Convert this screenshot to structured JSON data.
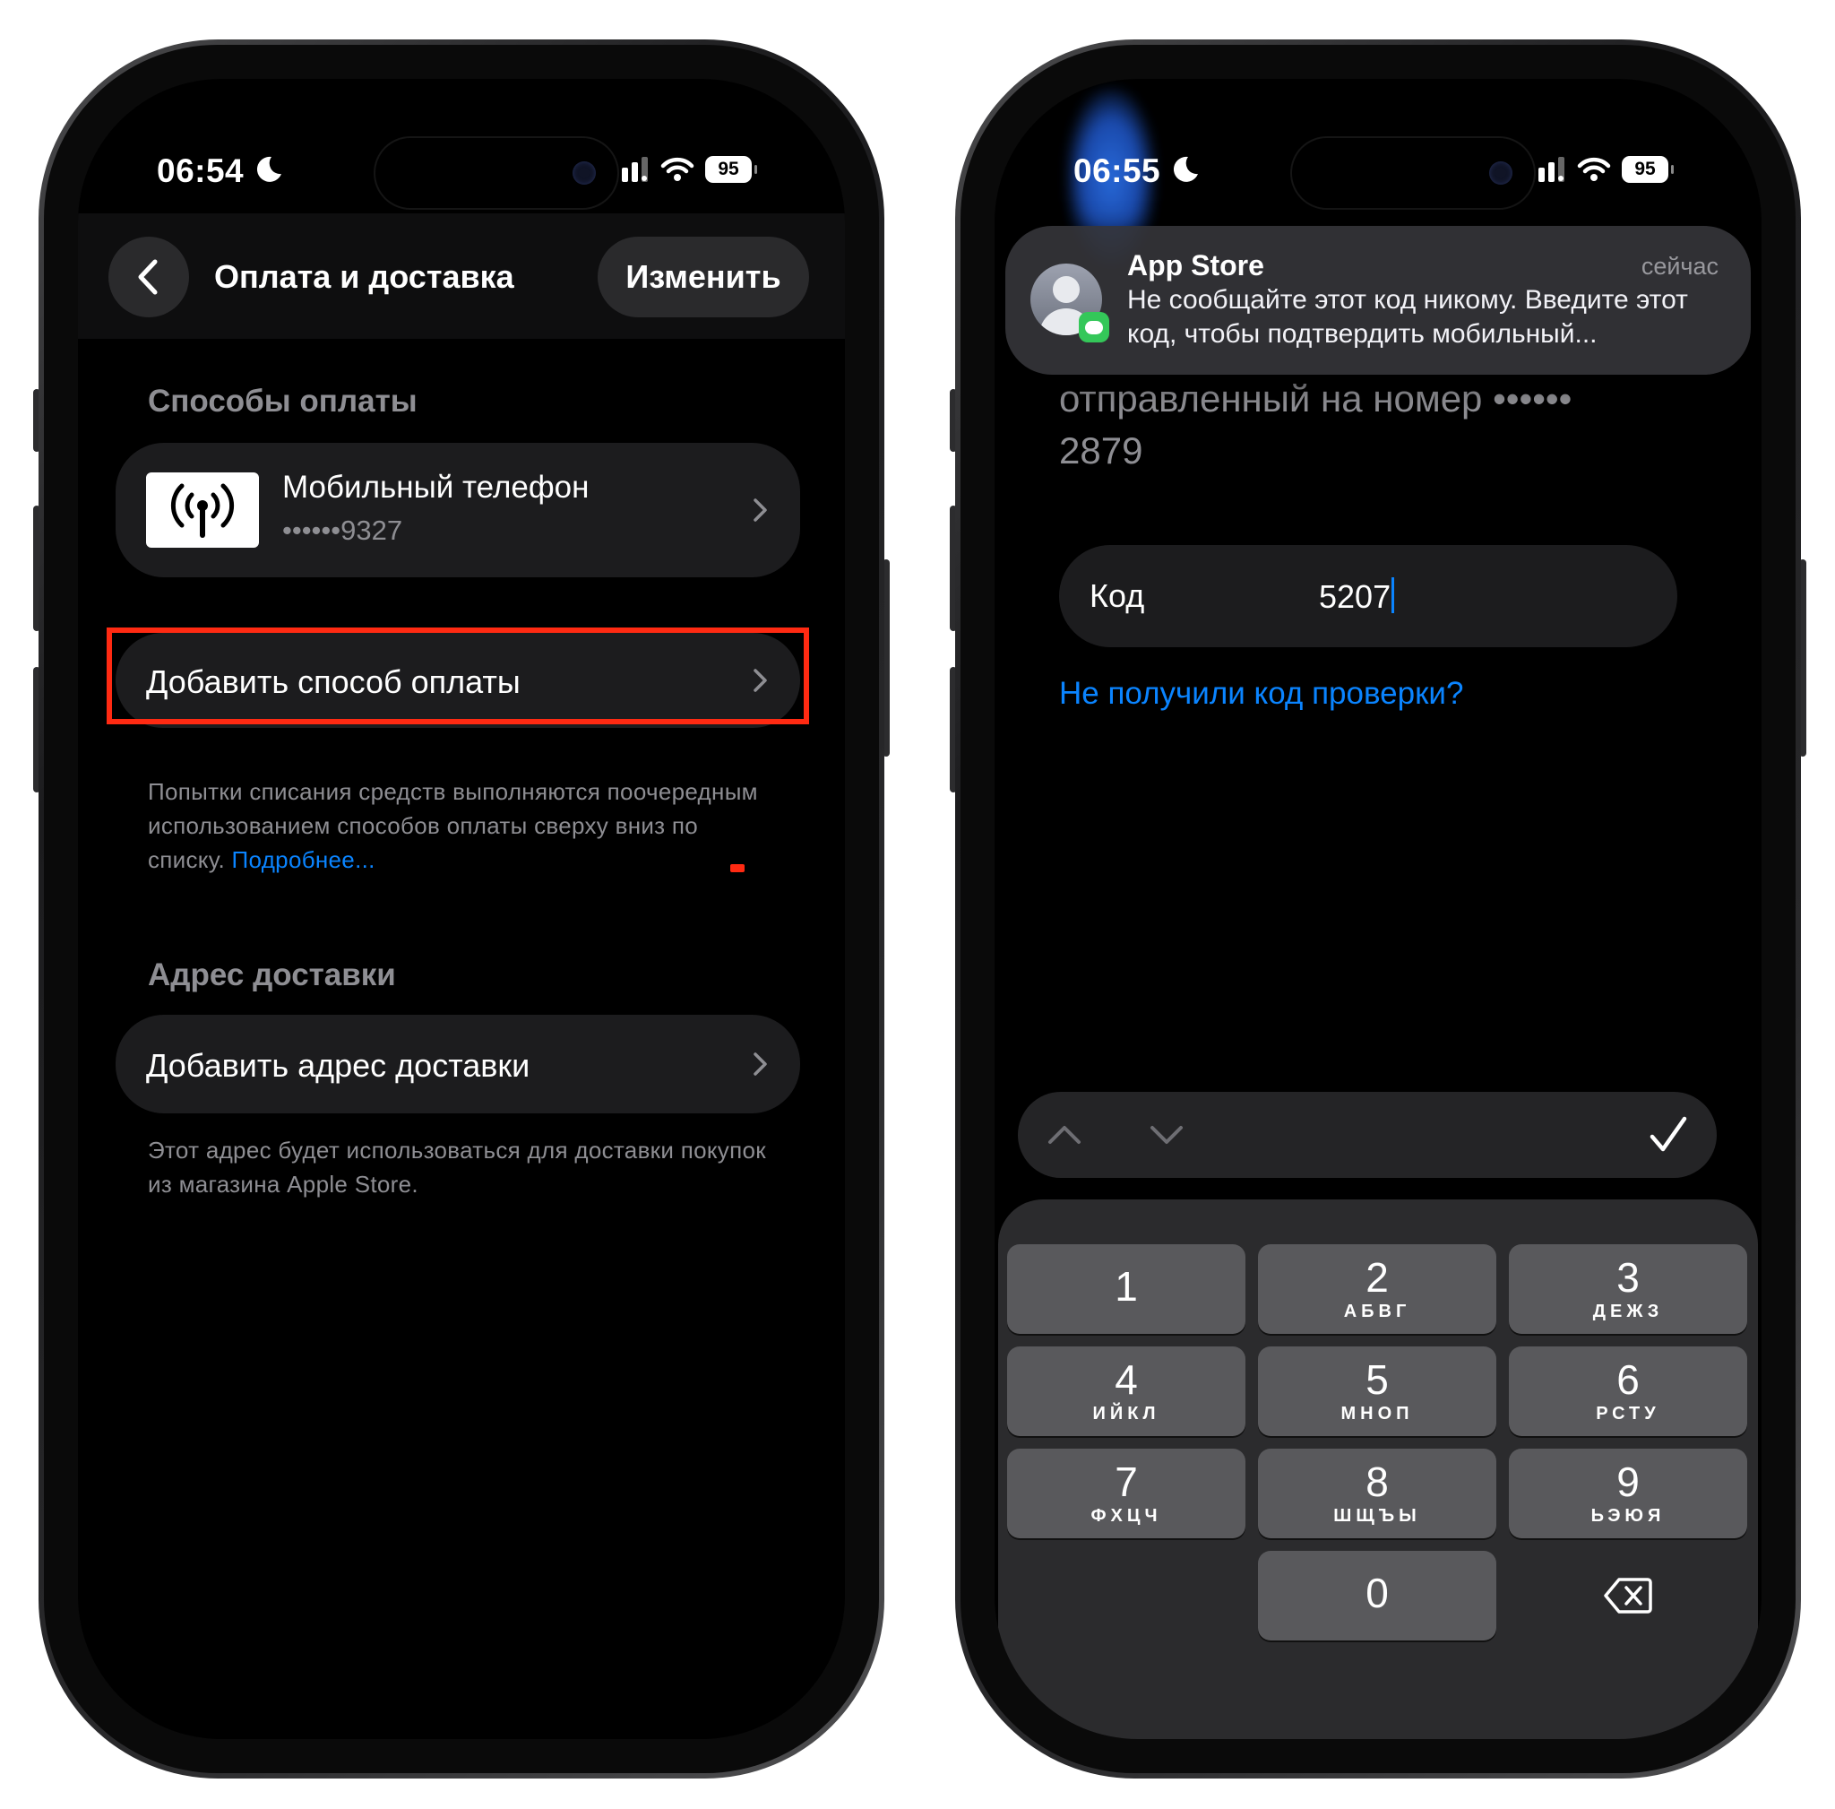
{
  "left_screen": {
    "status": {
      "time": "06:54",
      "battery": "95"
    },
    "nav": {
      "title": "Оплата и доставка",
      "edit_label": "Изменить"
    },
    "payment_section": {
      "title": "Способы оплаты",
      "method": {
        "name": "Мобильный телефон",
        "number": "••••••9327"
      },
      "add_label": "Добавить способ оплаты",
      "footnote": "Попытки списания средств выполняются поочередным использованием способов оплаты сверху вниз по списку.",
      "footnote_link": "Подробнее..."
    },
    "delivery_section": {
      "title": "Адрес доставки",
      "add_label": "Добавить адрес доставки",
      "footnote": "Этот адрес будет использоваться для доставки покупок из магазина Apple Store."
    }
  },
  "right_screen": {
    "status": {
      "time": "06:55",
      "battery": "95"
    },
    "notification": {
      "app": "App Store",
      "time": "сейчас",
      "body": "Не сообщайте этот код никому. Введите этот код, чтобы подтвердить мобильный..."
    },
    "sent_line1": "отправленный на номер ••••••",
    "sent_line2": "2879",
    "code_field": {
      "label": "Код",
      "value": "5207"
    },
    "resend_link": "Не получили код проверки?",
    "keypad": [
      {
        "digit": "1",
        "letters": ""
      },
      {
        "digit": "2",
        "letters": "АБВГ"
      },
      {
        "digit": "3",
        "letters": "ДЕЖЗ"
      },
      {
        "digit": "4",
        "letters": "ИЙКЛ"
      },
      {
        "digit": "5",
        "letters": "МНОП"
      },
      {
        "digit": "6",
        "letters": "РСТУ"
      },
      {
        "digit": "7",
        "letters": "ФХЦЧ"
      },
      {
        "digit": "8",
        "letters": "ШЩЪЫ"
      },
      {
        "digit": "9",
        "letters": "ЬЭЮЯ"
      },
      {
        "digit": "0",
        "letters": ""
      }
    ]
  },
  "colors": {
    "accent": "#0a84ff",
    "highlight": "#ff2a12",
    "card": "#1c1c1e",
    "secondary_text": "#8e8e93"
  },
  "icons": [
    "moon-icon",
    "signal-icon",
    "wifi-icon",
    "back-chevron-icon",
    "antenna-icon",
    "chevron-right-icon",
    "contact-avatar-icon",
    "messages-badge-icon",
    "arrow-up-icon",
    "arrow-down-icon",
    "checkmark-icon",
    "delete-key-icon"
  ]
}
